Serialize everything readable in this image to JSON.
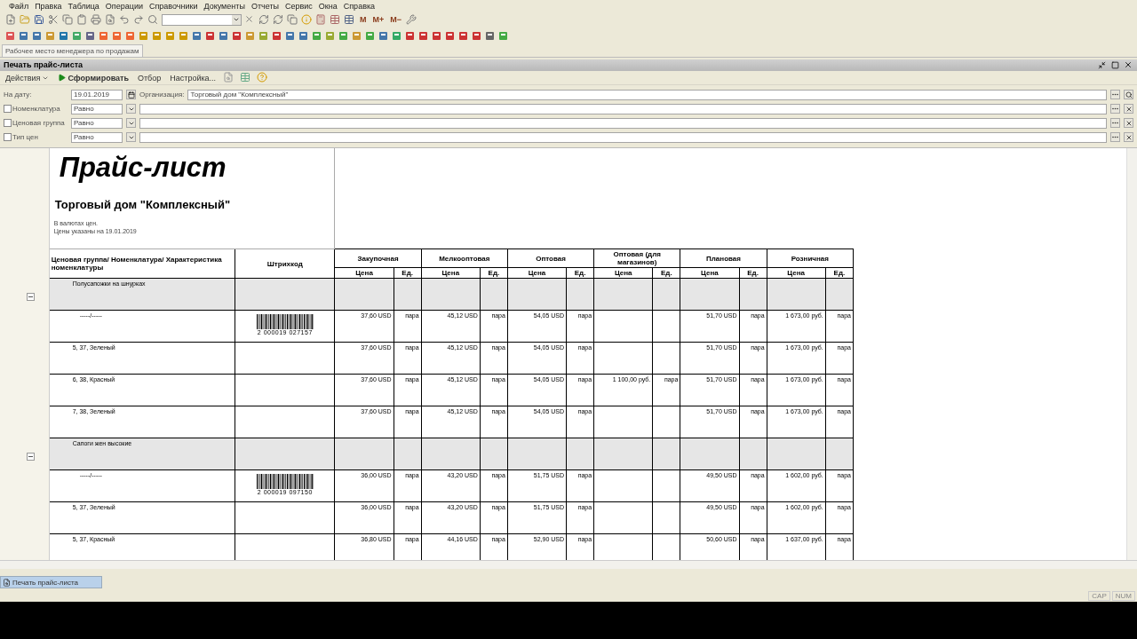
{
  "menu": [
    "Файл",
    "Правка",
    "Таблица",
    "Операции",
    "Справочники",
    "Документы",
    "Отчеты",
    "Сервис",
    "Окна",
    "Справка"
  ],
  "toolbar": {
    "memory_buttons": [
      "M",
      "M+",
      "M−"
    ]
  },
  "tab": {
    "label": "Рабочее место менеджера по продажам"
  },
  "window": {
    "title": "Печать прайс-листа"
  },
  "actions": [
    {
      "label": "Действия",
      "kind": "menu"
    },
    {
      "label": "Сформировать",
      "kind": "primary"
    },
    {
      "label": "Отбор",
      "kind": "plain"
    },
    {
      "label": "Настройка...",
      "kind": "plain"
    }
  ],
  "date_field": {
    "label": "На дату:",
    "value": "19.01.2019"
  },
  "organization_field": {
    "label": "Организация:",
    "value": "Торговый дом \"Комплексный\""
  },
  "filters": [
    {
      "label": "Номенклатура",
      "checked": false,
      "condition": "Равно"
    },
    {
      "label": "Ценовая группа",
      "checked": false,
      "condition": "Равно"
    },
    {
      "label": "Тип цен",
      "checked": false,
      "condition": "Равно"
    }
  ],
  "report": {
    "title": "Прайс-лист",
    "company": "Торговый дом \"Комплексный\"",
    "notes": [
      "В валютах цен.",
      "Цены указаны на 19.01.2019"
    ],
    "name_column": "Ценовая группа/ Номенклатура/ Характеристика номенклатуры",
    "barcode_column": "Штрихкод",
    "price_types": [
      {
        "name": "Закупочная",
        "price_label": "Цена",
        "unit_label": "Ед."
      },
      {
        "name": "Мелкооптовая",
        "price_label": "Цена",
        "unit_label": "Ед."
      },
      {
        "name": "Оптовая",
        "price_label": "Цена",
        "unit_label": "Ед."
      },
      {
        "name": "Оптовая (для магазинов)",
        "price_label": "Цена",
        "unit_label": "Ед."
      },
      {
        "name": "Плановая",
        "price_label": "Цена",
        "unit_label": "Ед."
      },
      {
        "name": "Розничная",
        "price_label": "Цена",
        "unit_label": "Ед."
      }
    ],
    "rows": [
      {
        "kind": "group",
        "name": "Полусапожки на шнурках",
        "expanded": true
      },
      {
        "kind": "item",
        "name": "-----/-----",
        "barcode": "2 000019 027157",
        "prices": [
          {
            "kind": "price",
            "price": "37,60 USD",
            "unit": "пара"
          },
          {
            "kind": "price",
            "price": "45,12 USD",
            "unit": "пара"
          },
          {
            "kind": "price",
            "price": "54,05 USD",
            "unit": "пара"
          },
          {
            "kind": "blank"
          },
          {
            "kind": "price",
            "price": "51,70 USD",
            "unit": "пара"
          },
          {
            "kind": "price",
            "price": "1 673,00 руб.",
            "unit": "пара"
          }
        ]
      },
      {
        "kind": "item",
        "name": "5, 37, Зеленый",
        "prices": [
          {
            "kind": "price",
            "price": "37,60 USD",
            "unit": "пара"
          },
          {
            "kind": "price",
            "price": "45,12 USD",
            "unit": "пара"
          },
          {
            "kind": "price",
            "price": "54,05 USD",
            "unit": "пара"
          },
          {
            "kind": "blank"
          },
          {
            "kind": "price",
            "price": "51,70 USD",
            "unit": "пара"
          },
          {
            "kind": "price",
            "price": "1 673,00 руб.",
            "unit": "пара"
          }
        ]
      },
      {
        "kind": "item",
        "name": "6, 38, Красный",
        "prices": [
          {
            "kind": "price",
            "price": "37,60 USD",
            "unit": "пара"
          },
          {
            "kind": "price",
            "price": "45,12 USD",
            "unit": "пара"
          },
          {
            "kind": "price",
            "price": "54,05 USD",
            "unit": "пара"
          },
          {
            "kind": "price",
            "price": "1 100,00 руб.",
            "unit": "пара"
          },
          {
            "kind": "price",
            "price": "51,70 USD",
            "unit": "пара"
          },
          {
            "kind": "price",
            "price": "1 673,00 руб.",
            "unit": "пара"
          }
        ]
      },
      {
        "kind": "item",
        "name": "7, 38, Зеленый",
        "prices": [
          {
            "kind": "price",
            "price": "37,60 USD",
            "unit": "пара"
          },
          {
            "kind": "price",
            "price": "45,12 USD",
            "unit": "пара"
          },
          {
            "kind": "price",
            "price": "54,05 USD",
            "unit": "пара"
          },
          {
            "kind": "blank"
          },
          {
            "kind": "price",
            "price": "51,70 USD",
            "unit": "пара"
          },
          {
            "kind": "price",
            "price": "1 673,00 руб.",
            "unit": "пара"
          }
        ]
      },
      {
        "kind": "group",
        "name": "Сапоги жен высокие",
        "expanded": true
      },
      {
        "kind": "item",
        "name": "-----/-----",
        "barcode": "2 000019 097150",
        "prices": [
          {
            "kind": "price",
            "price": "36,00 USD",
            "unit": "пара"
          },
          {
            "kind": "price",
            "price": "43,20 USD",
            "unit": "пара"
          },
          {
            "kind": "price",
            "price": "51,75 USD",
            "unit": "пара"
          },
          {
            "kind": "blank"
          },
          {
            "kind": "price",
            "price": "49,50 USD",
            "unit": "пара"
          },
          {
            "kind": "price",
            "price": "1 602,00 руб.",
            "unit": "пара"
          }
        ]
      },
      {
        "kind": "item",
        "name": "5, 37, Зеленый",
        "prices": [
          {
            "kind": "price",
            "price": "36,00 USD",
            "unit": "пара"
          },
          {
            "kind": "price",
            "price": "43,20 USD",
            "unit": "пара"
          },
          {
            "kind": "price",
            "price": "51,75 USD",
            "unit": "пара"
          },
          {
            "kind": "blank"
          },
          {
            "kind": "price",
            "price": "49,50 USD",
            "unit": "пара"
          },
          {
            "kind": "price",
            "price": "1 602,00 руб.",
            "unit": "пара"
          }
        ]
      },
      {
        "kind": "item",
        "name": "5, 37, Красный",
        "prices": [
          {
            "kind": "price",
            "price": "36,80 USD",
            "unit": "пара"
          },
          {
            "kind": "price",
            "price": "44,16 USD",
            "unit": "пара"
          },
          {
            "kind": "price",
            "price": "52,90 USD",
            "unit": "пара"
          },
          {
            "kind": "blank"
          },
          {
            "kind": "price",
            "price": "50,60 USD",
            "unit": "пара"
          },
          {
            "kind": "price",
            "price": "1 637,00 руб.",
            "unit": "пара"
          }
        ]
      }
    ]
  },
  "taskbar": [
    {
      "label": "Печать прайс-листа",
      "selected": true
    }
  ],
  "status": [
    "CAP",
    "NUM"
  ]
}
